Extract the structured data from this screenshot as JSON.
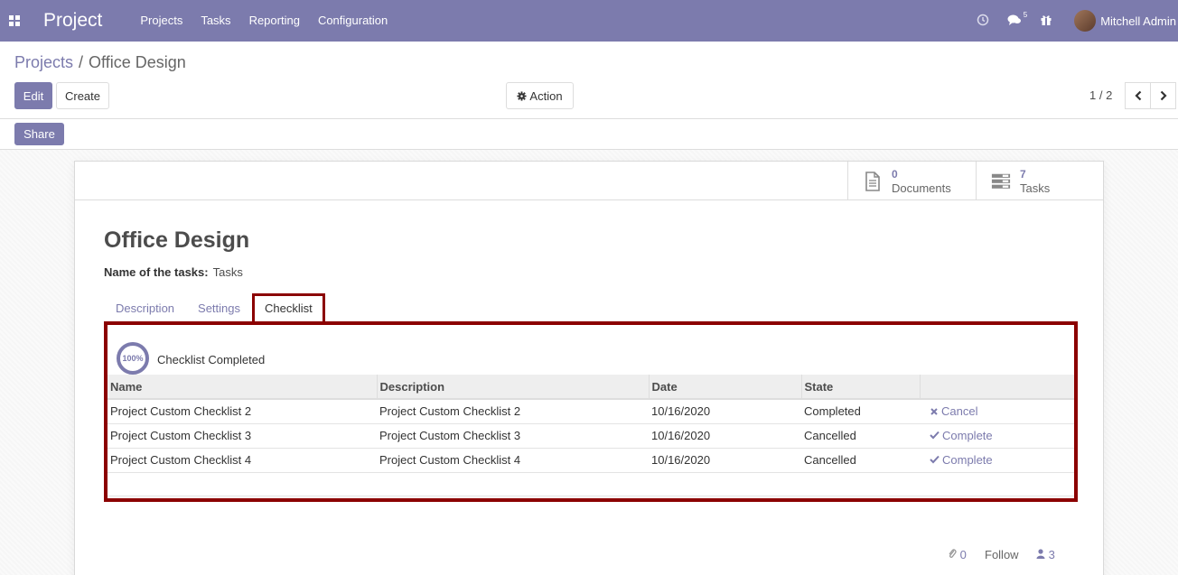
{
  "navbar": {
    "app_name": "Project",
    "menu": [
      "Projects",
      "Tasks",
      "Reporting",
      "Configuration"
    ],
    "messages_count": "5",
    "user_name": "Mitchell Admin"
  },
  "breadcrumb": {
    "parent": "Projects",
    "separator": "/",
    "current": "Office Design"
  },
  "buttons": {
    "edit": "Edit",
    "create": "Create",
    "action": "Action",
    "share": "Share"
  },
  "pager": {
    "value": "1 / 2"
  },
  "stat_buttons": {
    "documents": {
      "value": "0",
      "label": "Documents"
    },
    "tasks": {
      "value": "7",
      "label": "Tasks"
    }
  },
  "record": {
    "title": "Office Design",
    "tasks_label": "Name of the tasks:",
    "tasks_value": "Tasks"
  },
  "tabs": [
    "Description",
    "Settings",
    "Checklist"
  ],
  "checklist": {
    "progress": "100%",
    "progress_label": "Checklist Completed",
    "columns": [
      "Name",
      "Description",
      "Date",
      "State",
      ""
    ],
    "rows": [
      {
        "name": "Project Custom Checklist 2",
        "description": "Project Custom Checklist 2",
        "date": "10/16/2020",
        "state": "Completed",
        "action": "Cancel"
      },
      {
        "name": "Project Custom Checklist 3",
        "description": "Project Custom Checklist 3",
        "date": "10/16/2020",
        "state": "Cancelled",
        "action": "Complete"
      },
      {
        "name": "Project Custom Checklist 4",
        "description": "Project Custom Checklist 4",
        "date": "10/16/2020",
        "state": "Cancelled",
        "action": "Complete"
      }
    ]
  },
  "chatter": {
    "attachments": "0",
    "follow": "Follow",
    "followers": "3"
  },
  "colors": {
    "brand": "#7c7bad",
    "highlight": "#8b0000"
  }
}
